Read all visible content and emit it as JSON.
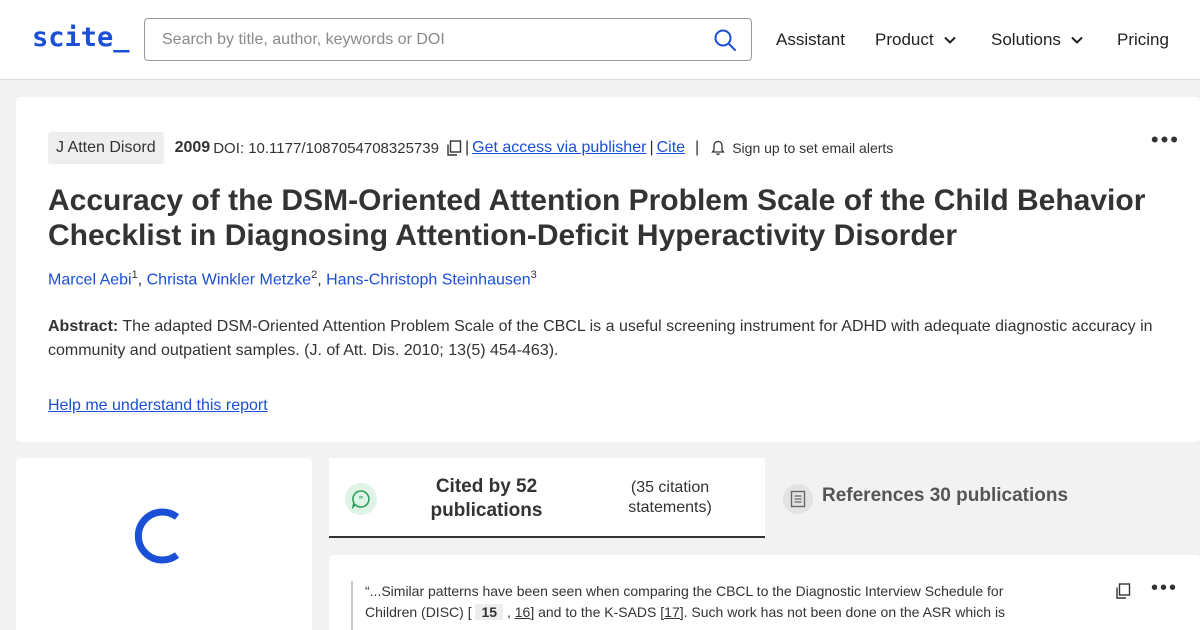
{
  "header": {
    "logo": "scite_",
    "search_placeholder": "Search by title, author, keywords or DOI",
    "nav": {
      "assistant": "Assistant",
      "product": "Product",
      "solutions": "Solutions",
      "pricing": "Pricing"
    }
  },
  "article": {
    "journal": "J Atten Disord",
    "year": "2009",
    "doi": "DOI: 10.1177/1087054708325739",
    "get_access": "Get access via publisher",
    "cite": "Cite",
    "alerts": "Sign up to set email alerts",
    "more": "•••",
    "title": "Accuracy of the DSM-Oriented Attention Problem Scale of the Child Behavior Checklist in Diagnosing Attention-Deficit Hyperactivity Disorder",
    "authors": [
      {
        "name": "Marcel Aebi",
        "sup": "1"
      },
      {
        "name": "Christa Winkler Metzke",
        "sup": "2"
      },
      {
        "name": "Hans-Christoph Steinhausen",
        "sup": "3"
      }
    ],
    "abstract_label": "Abstract:",
    "abstract_text": "The adapted DSM-Oriented Attention Problem Scale of the CBCL is a useful screening instrument for ADHD with adequate diagnostic accuracy in community and outpatient samples. (J. of Att. Dis. 2010; 13(5) 454-463).",
    "help_link": "Help me understand this report"
  },
  "tabs": {
    "cited_title": "Cited by 52 publications",
    "cited_statements": "(35 citation statements)",
    "references_title": "References 30 publications"
  },
  "citation": {
    "text_start": "“...Similar patterns have been seen when comparing the CBCL to the Diagnostic Interview Schedule for Children (DISC) [",
    "ref1": "15",
    "sep1": ",",
    "ref2": "16",
    "text_mid": "] and to the K-SADS [",
    "ref3": "17",
    "text_end": "]. Such work has not been done on the ASR which is a",
    "more": "•••"
  },
  "colors": {
    "brand": "#1a4fd6",
    "cite_bubble_bg": "#dff3e6",
    "cite_bubble_icon": "#2e9e5b"
  },
  "icons": {
    "search": "search-icon",
    "chevron": "chevron-down-icon",
    "copy": "copy-icon",
    "bell": "bell-icon",
    "spinner": "loading-spinner-icon",
    "cite_bubble": "chat-quote-icon",
    "references": "document-icon"
  }
}
